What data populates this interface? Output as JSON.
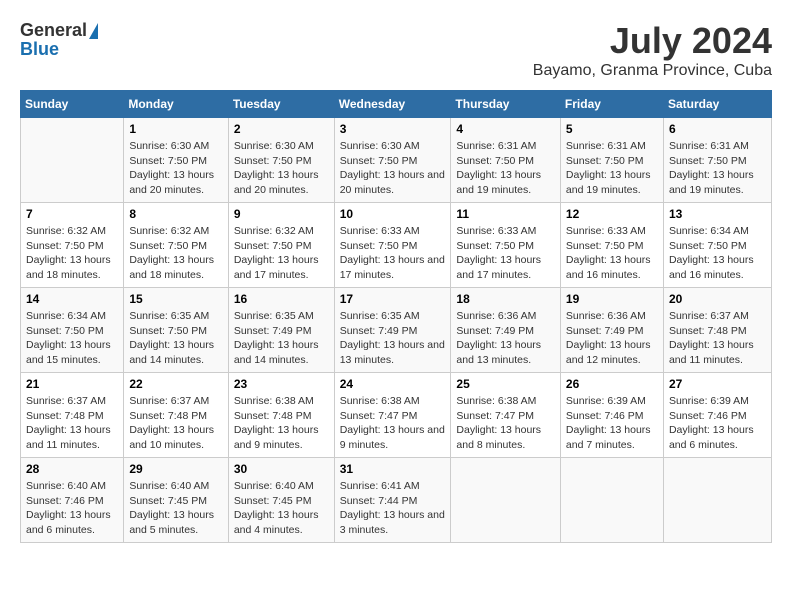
{
  "header": {
    "logo_general": "General",
    "logo_blue": "Blue",
    "month": "July 2024",
    "location": "Bayamo, Granma Province, Cuba"
  },
  "calendar": {
    "days_of_week": [
      "Sunday",
      "Monday",
      "Tuesday",
      "Wednesday",
      "Thursday",
      "Friday",
      "Saturday"
    ],
    "weeks": [
      [
        {
          "day": "",
          "sunrise": "",
          "sunset": "",
          "daylight": ""
        },
        {
          "day": "1",
          "sunrise": "6:30 AM",
          "sunset": "7:50 PM",
          "daylight": "13 hours and 20 minutes."
        },
        {
          "day": "2",
          "sunrise": "6:30 AM",
          "sunset": "7:50 PM",
          "daylight": "13 hours and 20 minutes."
        },
        {
          "day": "3",
          "sunrise": "6:30 AM",
          "sunset": "7:50 PM",
          "daylight": "13 hours and 20 minutes."
        },
        {
          "day": "4",
          "sunrise": "6:31 AM",
          "sunset": "7:50 PM",
          "daylight": "13 hours and 19 minutes."
        },
        {
          "day": "5",
          "sunrise": "6:31 AM",
          "sunset": "7:50 PM",
          "daylight": "13 hours and 19 minutes."
        },
        {
          "day": "6",
          "sunrise": "6:31 AM",
          "sunset": "7:50 PM",
          "daylight": "13 hours and 19 minutes."
        }
      ],
      [
        {
          "day": "7",
          "sunrise": "6:32 AM",
          "sunset": "7:50 PM",
          "daylight": "13 hours and 18 minutes."
        },
        {
          "day": "8",
          "sunrise": "6:32 AM",
          "sunset": "7:50 PM",
          "daylight": "13 hours and 18 minutes."
        },
        {
          "day": "9",
          "sunrise": "6:32 AM",
          "sunset": "7:50 PM",
          "daylight": "13 hours and 17 minutes."
        },
        {
          "day": "10",
          "sunrise": "6:33 AM",
          "sunset": "7:50 PM",
          "daylight": "13 hours and 17 minutes."
        },
        {
          "day": "11",
          "sunrise": "6:33 AM",
          "sunset": "7:50 PM",
          "daylight": "13 hours and 17 minutes."
        },
        {
          "day": "12",
          "sunrise": "6:33 AM",
          "sunset": "7:50 PM",
          "daylight": "13 hours and 16 minutes."
        },
        {
          "day": "13",
          "sunrise": "6:34 AM",
          "sunset": "7:50 PM",
          "daylight": "13 hours and 16 minutes."
        }
      ],
      [
        {
          "day": "14",
          "sunrise": "6:34 AM",
          "sunset": "7:50 PM",
          "daylight": "13 hours and 15 minutes."
        },
        {
          "day": "15",
          "sunrise": "6:35 AM",
          "sunset": "7:50 PM",
          "daylight": "13 hours and 14 minutes."
        },
        {
          "day": "16",
          "sunrise": "6:35 AM",
          "sunset": "7:49 PM",
          "daylight": "13 hours and 14 minutes."
        },
        {
          "day": "17",
          "sunrise": "6:35 AM",
          "sunset": "7:49 PM",
          "daylight": "13 hours and 13 minutes."
        },
        {
          "day": "18",
          "sunrise": "6:36 AM",
          "sunset": "7:49 PM",
          "daylight": "13 hours and 13 minutes."
        },
        {
          "day": "19",
          "sunrise": "6:36 AM",
          "sunset": "7:49 PM",
          "daylight": "13 hours and 12 minutes."
        },
        {
          "day": "20",
          "sunrise": "6:37 AM",
          "sunset": "7:48 PM",
          "daylight": "13 hours and 11 minutes."
        }
      ],
      [
        {
          "day": "21",
          "sunrise": "6:37 AM",
          "sunset": "7:48 PM",
          "daylight": "13 hours and 11 minutes."
        },
        {
          "day": "22",
          "sunrise": "6:37 AM",
          "sunset": "7:48 PM",
          "daylight": "13 hours and 10 minutes."
        },
        {
          "day": "23",
          "sunrise": "6:38 AM",
          "sunset": "7:48 PM",
          "daylight": "13 hours and 9 minutes."
        },
        {
          "day": "24",
          "sunrise": "6:38 AM",
          "sunset": "7:47 PM",
          "daylight": "13 hours and 9 minutes."
        },
        {
          "day": "25",
          "sunrise": "6:38 AM",
          "sunset": "7:47 PM",
          "daylight": "13 hours and 8 minutes."
        },
        {
          "day": "26",
          "sunrise": "6:39 AM",
          "sunset": "7:46 PM",
          "daylight": "13 hours and 7 minutes."
        },
        {
          "day": "27",
          "sunrise": "6:39 AM",
          "sunset": "7:46 PM",
          "daylight": "13 hours and 6 minutes."
        }
      ],
      [
        {
          "day": "28",
          "sunrise": "6:40 AM",
          "sunset": "7:46 PM",
          "daylight": "13 hours and 6 minutes."
        },
        {
          "day": "29",
          "sunrise": "6:40 AM",
          "sunset": "7:45 PM",
          "daylight": "13 hours and 5 minutes."
        },
        {
          "day": "30",
          "sunrise": "6:40 AM",
          "sunset": "7:45 PM",
          "daylight": "13 hours and 4 minutes."
        },
        {
          "day": "31",
          "sunrise": "6:41 AM",
          "sunset": "7:44 PM",
          "daylight": "13 hours and 3 minutes."
        },
        {
          "day": "",
          "sunrise": "",
          "sunset": "",
          "daylight": ""
        },
        {
          "day": "",
          "sunrise": "",
          "sunset": "",
          "daylight": ""
        },
        {
          "day": "",
          "sunrise": "",
          "sunset": "",
          "daylight": ""
        }
      ]
    ],
    "sunrise_label": "Sunrise:",
    "sunset_label": "Sunset:",
    "daylight_label": "Daylight:"
  }
}
